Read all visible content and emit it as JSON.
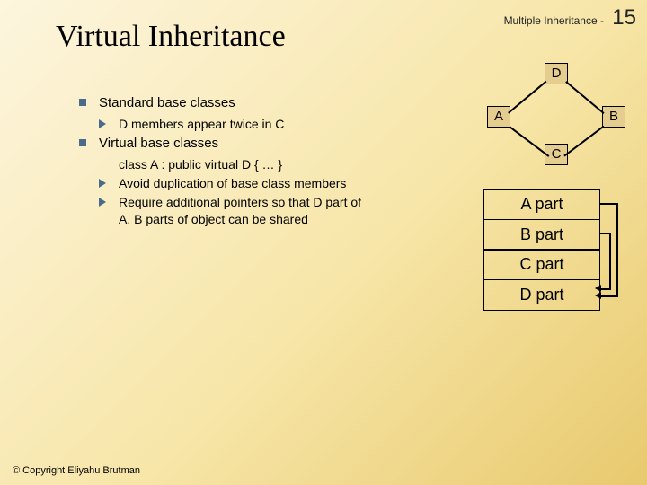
{
  "header": {
    "section": "Multiple Inheritance -",
    "page_num": "15"
  },
  "title": "Virtual Inheritance",
  "bullets": {
    "b1": "Standard base classes",
    "b1a": "D members appear twice in C",
    "b2": "Virtual base classes",
    "b2code": "class A : public virtual D { … }",
    "b2a": "Avoid duplication of base class members",
    "b2b": "Require additional pointers so that D part of A, B parts of object can be shared"
  },
  "nodes": {
    "D": "D",
    "A": "A",
    "B": "B",
    "C": "C"
  },
  "parts": {
    "a": "A part",
    "b": "B part",
    "c": "C part",
    "d": "D part"
  },
  "footer": "© Copyright Eliyahu Brutman"
}
